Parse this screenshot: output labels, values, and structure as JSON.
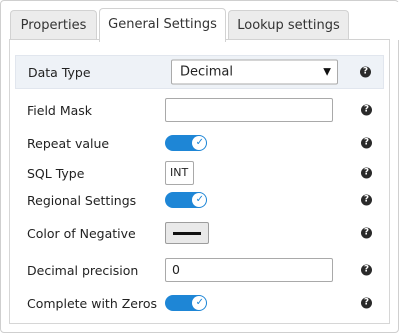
{
  "tabs": [
    {
      "label": "Properties"
    },
    {
      "label": "General Settings"
    },
    {
      "label": "Lookup settings"
    }
  ],
  "fields": {
    "data_type": {
      "label": "Data Type",
      "value": "Decimal"
    },
    "field_mask": {
      "label": "Field Mask",
      "value": ""
    },
    "repeat_value": {
      "label": "Repeat value",
      "on": true
    },
    "sql_type": {
      "label": "SQL Type",
      "value": "INT"
    },
    "regional_settings": {
      "label": "Regional Settings",
      "on": true
    },
    "color_of_negative": {
      "label": "Color of Negative",
      "color": "#111111"
    },
    "decimal_precision": {
      "label": "Decimal precision",
      "value": "0"
    },
    "complete_with_zeros": {
      "label": "Complete with Zeros",
      "on": true
    }
  },
  "help_glyph": "?",
  "caret_glyph": "▼",
  "toggle_check_glyph": "✓",
  "colors": {
    "accent": "#1e86d6",
    "row_highlight": "#eef2f7"
  }
}
